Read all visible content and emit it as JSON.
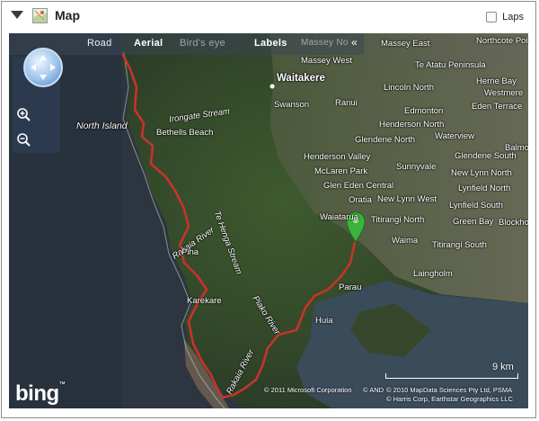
{
  "panel": {
    "title": "Map",
    "laps_label": "Laps",
    "laps_checked": false
  },
  "map": {
    "toolbar": {
      "road": "Road",
      "aerial": "Aerial",
      "birds_eye": "Bird's eye",
      "labels": "Labels",
      "collapse": "«"
    },
    "places": {
      "massey_east": "Massey East",
      "northcote_point": "Northcote Poi",
      "massey_west": "Massey West",
      "te_atatu": "Te Atatu Peninsula",
      "herne_bay": "Herne Bay",
      "waitakere": "Waitakere",
      "lincoln_north": "Lincoln North",
      "westmere": "Westmere",
      "swanson": "Swanson",
      "ranui": "Ranui",
      "edmonton": "Edmonton",
      "eden_terrace": "Eden Terrace",
      "irongate_stream": "Irongate Stream",
      "henderson_north": "Henderson North",
      "waterview": "Waterview",
      "north_island": "North Island",
      "bethells_beach": "Bethells Beach",
      "glendene_north": "Glendene North",
      "balmoral": "Balmo",
      "henderson_valley": "Henderson Valley",
      "sunnyvale": "Sunnyvale",
      "glendene_south": "Glendene South",
      "mclaren_park": "McLaren Park",
      "new_lynn_north": "New Lynn North",
      "glen_eden_central": "Glen Eden Central",
      "lynfield_north": "Lynfield North",
      "te_henga_stream": "Te Henga Stream",
      "oratia": "Oratia",
      "new_lynn_west": "New Lynn West",
      "lynfield_south": "Lynfield South",
      "rakaia_river_upper": "Rakaia River",
      "waiatarua": "Waiatarua",
      "titirangi_north": "Titirangi North",
      "green_bay": "Green Bay",
      "blockhouse": "Blockhouse",
      "waima": "Waima",
      "titirangi_south": "Titirangi South",
      "piha": "Piha",
      "laingholm": "Laingholm",
      "karekare": "Karekare",
      "parau": "Parau",
      "piako_river": "Piako River",
      "huia": "Huia",
      "rakaia_river_lower": "Rakaia River",
      "massey_north": "Massey No"
    },
    "scale_label": "9 km",
    "copyright_1": "© 2011 Microsoft Corporation",
    "copyright_and": "© AND",
    "copyright_2": "© 2010 MapData Sciences Pty Ltd, PSMA",
    "copyright_3": "© Harris Corp, Earthstar Geographics LLC",
    "logo": "bing",
    "logo_tm": "™"
  },
  "colors": {
    "route": "#c8322c",
    "marker": "#3db33d",
    "ocean": "#2c3540"
  }
}
